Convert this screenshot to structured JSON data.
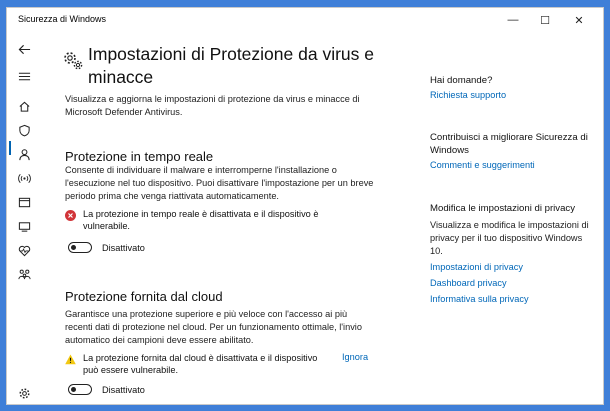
{
  "window": {
    "title": "Sicurezza di Windows",
    "controls": {
      "minimize": "—",
      "maximize": "☐",
      "close": "✕"
    }
  },
  "sidebar": {
    "items": [
      {
        "icon": "back-arrow-icon"
      },
      {
        "icon": "hamburger-menu-icon"
      },
      {
        "icon": "home-icon"
      },
      {
        "icon": "shield-icon",
        "active": true
      },
      {
        "icon": "account-icon"
      },
      {
        "icon": "network-icon"
      },
      {
        "icon": "app-browser-icon"
      },
      {
        "icon": "device-security-icon"
      },
      {
        "icon": "health-heart-icon"
      },
      {
        "icon": "family-icon"
      },
      {
        "icon": "gear-icon"
      }
    ]
  },
  "main": {
    "title": "Impostazioni di Protezione da virus e minacce",
    "description": "Visualizza e aggiorna le impostazioni di protezione da virus e minacce di Microsoft Defender Antivirus.",
    "realtime": {
      "heading": "Protezione in tempo reale",
      "description": "Consente di individuare il malware e interromperne l'installazione o l'esecuzione nel tuo dispositivo. Puoi disattivare l'impostazione per un breve periodo prima che venga riattivata automaticamente.",
      "warning": "La protezione in tempo reale è disattivata e il dispositivo è vulnerabile.",
      "toggle_label": "Disattivato",
      "toggle_on": false
    },
    "cloud": {
      "heading": "Protezione fornita dal cloud",
      "description": "Garantisce una protezione superiore e più veloce con l'accesso ai più recenti dati di protezione nel cloud. Per un funzionamento ottimale, l'invio automatico dei campioni deve essere abilitato.",
      "warning": "La protezione fornita dal cloud è disattivata e il dispositivo può essere vulnerabile.",
      "dismiss": "Ignora",
      "toggle_label": "Disattivato",
      "toggle_on": false
    }
  },
  "aside": {
    "questions_heading": "Hai domande?",
    "support_link": "Richiesta supporto",
    "improve_heading": "Contribuisci a migliorare Sicurezza di Windows",
    "feedback_link": "Commenti e suggerimenti",
    "privacy_heading": "Modifica le impostazioni di privacy",
    "privacy_description": "Visualizza e modifica le impostazioni di privacy per il tuo dispositivo Windows 10.",
    "privacy_links": [
      "Impostazioni di privacy",
      "Dashboard privacy",
      "Informativa sulla privacy"
    ]
  },
  "colors": {
    "accent": "#0067b8",
    "error": "#d13438",
    "warning": "#f2c811",
    "desktop": "#3f7fd8"
  }
}
